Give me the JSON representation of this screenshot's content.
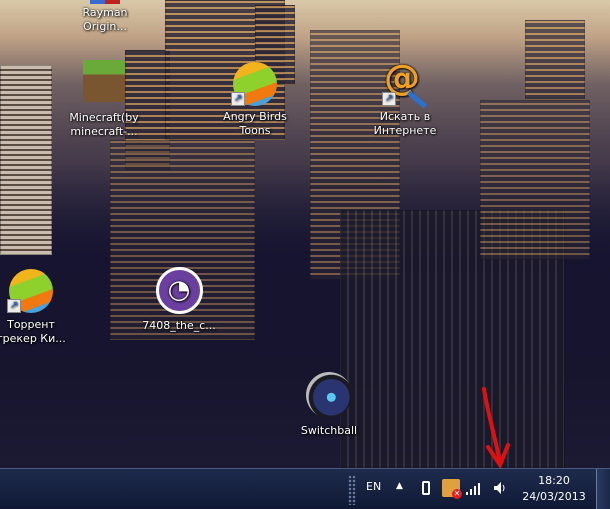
{
  "desktop": {
    "icons": [
      {
        "label": "Rayman Origin..."
      },
      {
        "label": "Minecraft(by minecraft-..."
      },
      {
        "label": "Angry Birds Toons"
      },
      {
        "label": "Искать в Интернете"
      },
      {
        "label": "Торрент трекер Ки..."
      },
      {
        "label": "7408_the_c..."
      },
      {
        "label": "Switchball"
      }
    ]
  },
  "taskbar": {
    "language": "EN",
    "time": "18:20",
    "date": "24/03/2013"
  },
  "colors": {
    "annotation": "#e01010"
  }
}
